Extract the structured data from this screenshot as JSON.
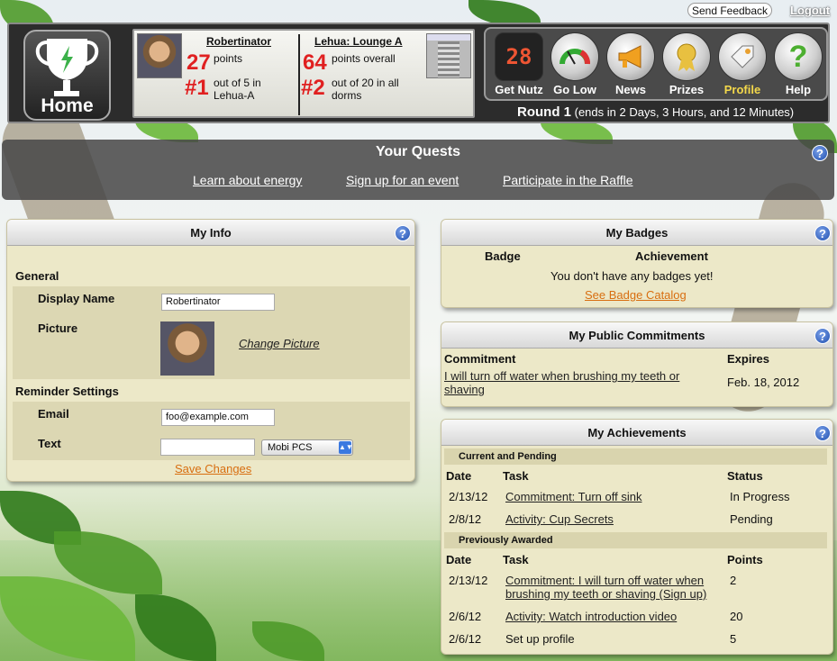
{
  "top": {
    "feedback": "Send Feedback",
    "logout": "Logout"
  },
  "home": {
    "label": "Home"
  },
  "stats": {
    "user_name": "Robertinator",
    "user_points": "27",
    "points_label": "points",
    "user_rank": "#1",
    "user_rank_text": "out of 5 in Lehua-A",
    "team_name": "Lehua: Lounge A",
    "team_points": "64",
    "team_points_label": "points overall",
    "team_rank": "#2",
    "team_rank_text": "out of 20 in all dorms"
  },
  "nav": [
    {
      "label": "Get Nutz",
      "icon": "nutz-counter-icon",
      "display": "28"
    },
    {
      "label": "Go Low",
      "icon": "gauge-icon"
    },
    {
      "label": "News",
      "icon": "megaphone-icon"
    },
    {
      "label": "Prizes",
      "icon": "medal-icon"
    },
    {
      "label": "Profile",
      "icon": "profile-tag-icon"
    },
    {
      "label": "Help",
      "icon": "question-icon"
    }
  ],
  "round": {
    "name": "Round 1",
    "detail": "(ends in 2 Days, 3 Hours, and 12 Minutes)"
  },
  "quests": {
    "title": "Your Quests",
    "items": [
      "Learn about energy ",
      "Sign up for an event ",
      "Participate in the Raffle"
    ]
  },
  "my_info": {
    "title": "My Info",
    "general": "General",
    "display_name_label": "Display Name",
    "display_name_value": "Robertinator",
    "picture_label": "Picture",
    "change_picture": "Change Picture",
    "reminder_settings": "Reminder Settings",
    "email_label": "Email",
    "email_value": "foo@example.com",
    "text_label": "Text",
    "text_value": "",
    "carrier": "Mobi PCS",
    "save": "Save Changes"
  },
  "badges": {
    "title": "My Badges",
    "col_badge": "Badge",
    "col_achievement": "Achievement",
    "empty": "You don't have any badges yet!",
    "catalog": "See Badge Catalog"
  },
  "commitments": {
    "title": "My Public Commitments",
    "col_commitment": "Commitment",
    "col_expires": "Expires",
    "rows": [
      {
        "text": "I will turn off water when brushing my teeth or shaving",
        "expires": "Feb. 18, 2012"
      }
    ]
  },
  "achievements": {
    "title": "My Achievements",
    "current_title": "Current and Pending",
    "current_cols": [
      "Date",
      "Task",
      "Status"
    ],
    "current_rows": [
      {
        "date": "2/13/12",
        "task": "Commitment: Turn off sink",
        "status": "In Progress"
      },
      {
        "date": "2/8/12",
        "task": "Activity: Cup Secrets",
        "status": "Pending"
      }
    ],
    "awarded_title": "Previously Awarded",
    "awarded_cols": [
      "Date",
      "Task",
      "Points"
    ],
    "awarded_rows": [
      {
        "date": "2/13/12",
        "task": "Commitment: I will turn off water when brushing my teeth or shaving (Sign up)",
        "points": "2"
      },
      {
        "date": "2/6/12",
        "task": "Activity: Watch introduction video",
        "points": "20"
      },
      {
        "date": "2/6/12",
        "task": "Set up profile",
        "points": "5"
      }
    ]
  }
}
